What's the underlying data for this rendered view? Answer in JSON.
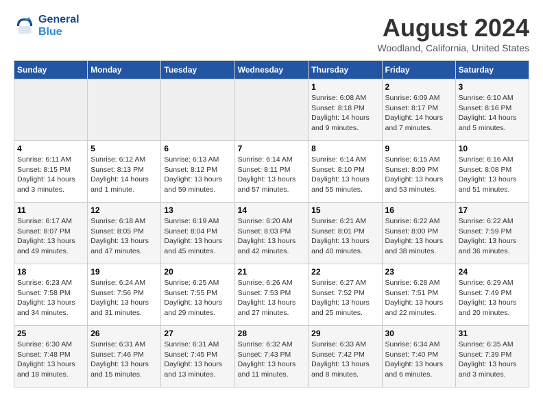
{
  "header": {
    "logo_line1": "General",
    "logo_line2": "Blue",
    "month_year": "August 2024",
    "location": "Woodland, California, United States"
  },
  "weekdays": [
    "Sunday",
    "Monday",
    "Tuesday",
    "Wednesday",
    "Thursday",
    "Friday",
    "Saturday"
  ],
  "weeks": [
    [
      {
        "day": "",
        "info": ""
      },
      {
        "day": "",
        "info": ""
      },
      {
        "day": "",
        "info": ""
      },
      {
        "day": "",
        "info": ""
      },
      {
        "day": "1",
        "info": "Sunrise: 6:08 AM\nSunset: 8:18 PM\nDaylight: 14 hours\nand 9 minutes."
      },
      {
        "day": "2",
        "info": "Sunrise: 6:09 AM\nSunset: 8:17 PM\nDaylight: 14 hours\nand 7 minutes."
      },
      {
        "day": "3",
        "info": "Sunrise: 6:10 AM\nSunset: 8:16 PM\nDaylight: 14 hours\nand 5 minutes."
      }
    ],
    [
      {
        "day": "4",
        "info": "Sunrise: 6:11 AM\nSunset: 8:15 PM\nDaylight: 14 hours\nand 3 minutes."
      },
      {
        "day": "5",
        "info": "Sunrise: 6:12 AM\nSunset: 8:13 PM\nDaylight: 14 hours\nand 1 minute."
      },
      {
        "day": "6",
        "info": "Sunrise: 6:13 AM\nSunset: 8:12 PM\nDaylight: 13 hours\nand 59 minutes."
      },
      {
        "day": "7",
        "info": "Sunrise: 6:14 AM\nSunset: 8:11 PM\nDaylight: 13 hours\nand 57 minutes."
      },
      {
        "day": "8",
        "info": "Sunrise: 6:14 AM\nSunset: 8:10 PM\nDaylight: 13 hours\nand 55 minutes."
      },
      {
        "day": "9",
        "info": "Sunrise: 6:15 AM\nSunset: 8:09 PM\nDaylight: 13 hours\nand 53 minutes."
      },
      {
        "day": "10",
        "info": "Sunrise: 6:16 AM\nSunset: 8:08 PM\nDaylight: 13 hours\nand 51 minutes."
      }
    ],
    [
      {
        "day": "11",
        "info": "Sunrise: 6:17 AM\nSunset: 8:07 PM\nDaylight: 13 hours\nand 49 minutes."
      },
      {
        "day": "12",
        "info": "Sunrise: 6:18 AM\nSunset: 8:05 PM\nDaylight: 13 hours\nand 47 minutes."
      },
      {
        "day": "13",
        "info": "Sunrise: 6:19 AM\nSunset: 8:04 PM\nDaylight: 13 hours\nand 45 minutes."
      },
      {
        "day": "14",
        "info": "Sunrise: 6:20 AM\nSunset: 8:03 PM\nDaylight: 13 hours\nand 42 minutes."
      },
      {
        "day": "15",
        "info": "Sunrise: 6:21 AM\nSunset: 8:01 PM\nDaylight: 13 hours\nand 40 minutes."
      },
      {
        "day": "16",
        "info": "Sunrise: 6:22 AM\nSunset: 8:00 PM\nDaylight: 13 hours\nand 38 minutes."
      },
      {
        "day": "17",
        "info": "Sunrise: 6:22 AM\nSunset: 7:59 PM\nDaylight: 13 hours\nand 36 minutes."
      }
    ],
    [
      {
        "day": "18",
        "info": "Sunrise: 6:23 AM\nSunset: 7:58 PM\nDaylight: 13 hours\nand 34 minutes."
      },
      {
        "day": "19",
        "info": "Sunrise: 6:24 AM\nSunset: 7:56 PM\nDaylight: 13 hours\nand 31 minutes."
      },
      {
        "day": "20",
        "info": "Sunrise: 6:25 AM\nSunset: 7:55 PM\nDaylight: 13 hours\nand 29 minutes."
      },
      {
        "day": "21",
        "info": "Sunrise: 6:26 AM\nSunset: 7:53 PM\nDaylight: 13 hours\nand 27 minutes."
      },
      {
        "day": "22",
        "info": "Sunrise: 6:27 AM\nSunset: 7:52 PM\nDaylight: 13 hours\nand 25 minutes."
      },
      {
        "day": "23",
        "info": "Sunrise: 6:28 AM\nSunset: 7:51 PM\nDaylight: 13 hours\nand 22 minutes."
      },
      {
        "day": "24",
        "info": "Sunrise: 6:29 AM\nSunset: 7:49 PM\nDaylight: 13 hours\nand 20 minutes."
      }
    ],
    [
      {
        "day": "25",
        "info": "Sunrise: 6:30 AM\nSunset: 7:48 PM\nDaylight: 13 hours\nand 18 minutes."
      },
      {
        "day": "26",
        "info": "Sunrise: 6:31 AM\nSunset: 7:46 PM\nDaylight: 13 hours\nand 15 minutes."
      },
      {
        "day": "27",
        "info": "Sunrise: 6:31 AM\nSunset: 7:45 PM\nDaylight: 13 hours\nand 13 minutes."
      },
      {
        "day": "28",
        "info": "Sunrise: 6:32 AM\nSunset: 7:43 PM\nDaylight: 13 hours\nand 11 minutes."
      },
      {
        "day": "29",
        "info": "Sunrise: 6:33 AM\nSunset: 7:42 PM\nDaylight: 13 hours\nand 8 minutes."
      },
      {
        "day": "30",
        "info": "Sunrise: 6:34 AM\nSunset: 7:40 PM\nDaylight: 13 hours\nand 6 minutes."
      },
      {
        "day": "31",
        "info": "Sunrise: 6:35 AM\nSunset: 7:39 PM\nDaylight: 13 hours\nand 3 minutes."
      }
    ]
  ]
}
